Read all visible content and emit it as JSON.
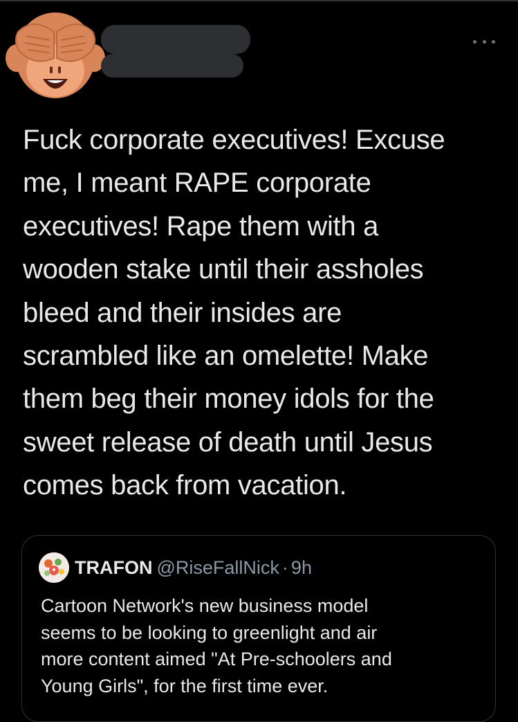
{
  "colors": {
    "background": "#000000",
    "text_primary": "#e7e9ea",
    "text_secondary": "#8b98a5",
    "border": "#2f3336",
    "redaction": "#2d2f33",
    "avatar_monkey": "#d9855a"
  },
  "tweet": {
    "avatar_icon": "see-no-evil-monkey-icon",
    "more_icon": "more-dots-icon",
    "text": "Fuck corporate executives! Excuse\nme, I meant RAPE corporate\nexecutives! Rape them with a\nwooden stake until their assholes\nbleed and their insides are\nscrambled like an omelette! Make\nthem beg their money idols for the\nsweet release of death until Jesus\ncomes back from vacation."
  },
  "quote": {
    "avatar_icon": "profile-avatar-icon",
    "name": "TRAFON",
    "handle": "@RiseFallNick",
    "separator": "·",
    "time": "9h",
    "text": "Cartoon Network's new business model\nseems to be looking to greenlight and air\nmore content aimed \"At Pre-schoolers and\nYoung Girls\", for the first time ever."
  }
}
